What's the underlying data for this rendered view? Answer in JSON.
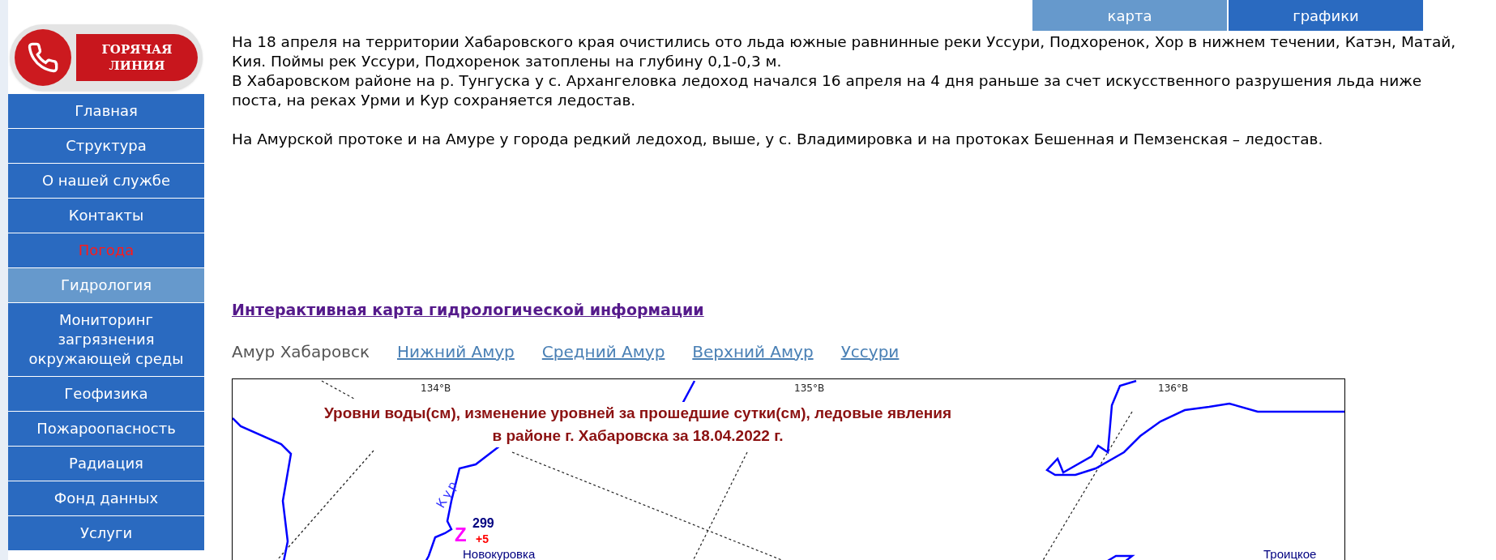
{
  "hotline_logo": {
    "line_1": "ГОРЯЧАЯ",
    "line_2": "ЛИНИЯ"
  },
  "sidebar": {
    "items": [
      {
        "label": "Главная",
        "selected": false,
        "emphasized": false
      },
      {
        "label": "Структура",
        "selected": false,
        "emphasized": false
      },
      {
        "label": "О нашей службе",
        "selected": false,
        "emphasized": false
      },
      {
        "label": "Контакты",
        "selected": false,
        "emphasized": false
      },
      {
        "label": "Погода",
        "selected": false,
        "emphasized": true
      },
      {
        "label": "Гидрология",
        "selected": true,
        "emphasized": false
      },
      {
        "label": "Мониторинг загрязнения окружающей среды",
        "selected": false,
        "emphasized": false
      },
      {
        "label": "Геофизика",
        "selected": false,
        "emphasized": false
      },
      {
        "label": "Пожароопасность",
        "selected": false,
        "emphasized": false
      },
      {
        "label": "Радиация",
        "selected": false,
        "emphasized": false
      },
      {
        "label": "Фонд данных",
        "selected": false,
        "emphasized": false
      },
      {
        "label": "Услуги",
        "selected": false,
        "emphasized": false
      }
    ]
  },
  "view_buttons": [
    {
      "label": "карта",
      "selected": true
    },
    {
      "label": "графики",
      "selected": false
    }
  ],
  "paragraphs": [
    "На 18 апреля на территории Хабаровского края очистились ото льда южные равнинные реки Уссури, Подхоренок, Хор в нижнем течении, Катэн, Матай, Кия. Поймы рек Уссури, Подхоренок затоплены на глубину 0,1-0,3 м.",
    "В Хабаровском районе на р. Тунгуска у с. Архангеловка ледоход начался 16 апреля на 4 дня раньше за счет искусственного разрушения льда ниже поста, на реках Урми и Кур сохраняется ледостав.",
    "На Амурской протоке и на Амуре у города редкий ледоход, выше, у с. Владимировка и на протоках Бешенная и Пемзенская – ледостав."
  ],
  "map_link": "Интерактивная карта гидрологической информации",
  "region_tabs": [
    {
      "label": "Амур Хабаровск",
      "selected": true
    },
    {
      "label": "Нижний Амур",
      "selected": false
    },
    {
      "label": "Средний Амур",
      "selected": false
    },
    {
      "label": "Верхний Амур",
      "selected": false
    },
    {
      "label": "Уссури",
      "selected": false
    }
  ],
  "map": {
    "title_line_1": "Уровни воды(см), изменение уровней за прошедшие сутки(см), ледовые явления",
    "title_line_2": "в районе г. Хабаровска за 18.04.2022 г.",
    "longitudes": [
      "134°В",
      "135°В",
      "136°В"
    ],
    "river_label": "Кур",
    "stations": [
      {
        "marker": "Z",
        "level": "299",
        "change": "+5",
        "name": "Новокуровка"
      }
    ],
    "places": [
      "Троицкое"
    ]
  }
}
